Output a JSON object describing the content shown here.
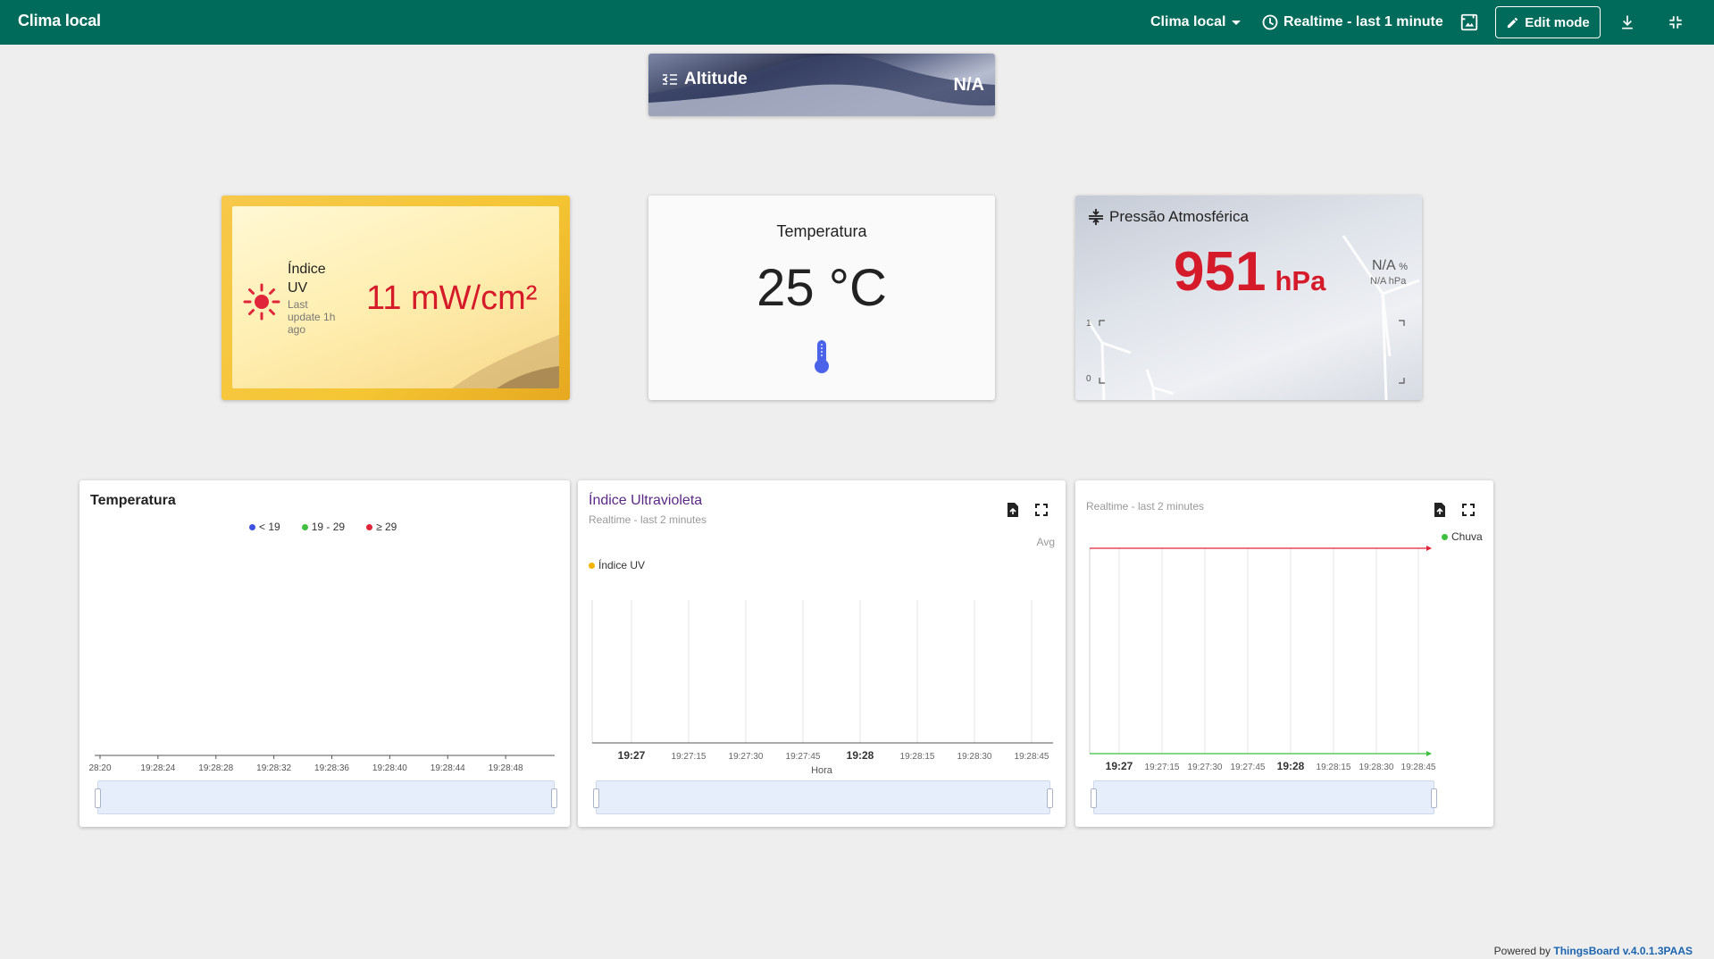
{
  "header": {
    "title": "Clima local",
    "dashboard_select": "Clima local",
    "timewindow": "Realtime - last 1 minute",
    "edit_mode": "Edit mode"
  },
  "altitude": {
    "label": "Altitude",
    "value": "N/A"
  },
  "uv_card": {
    "label": "Índice UV",
    "updated": "Last update 1h ago",
    "value": "11 mW/cm²"
  },
  "temperature_card": {
    "title": "Temperatura",
    "value": "25 °C"
  },
  "pressure_card": {
    "title": "Pressão Atmosférica",
    "value": "951",
    "unit": "hPa",
    "secondary_value": "N/A",
    "secondary_unit": "%",
    "tertiary": "N/A hPa",
    "axis_top": "1",
    "axis_bottom": "0"
  },
  "charts": {
    "temperature": {
      "title": "Temperatura",
      "legend": [
        {
          "label": "< 19",
          "color": "#3f51e0"
        },
        {
          "label": "19 - 29",
          "color": "#3fbf3f"
        },
        {
          "label": "≥ 29",
          "color": "#e0243a"
        }
      ],
      "x_ticks": [
        "28:20",
        "19:28:24",
        "19:28:28",
        "19:28:32",
        "19:28:36",
        "19:28:40",
        "19:28:44",
        "19:28:48"
      ]
    },
    "uv": {
      "title": "Índice Ultravioleta",
      "subtitle": "Realtime - last 2 minutes",
      "aggregation": "Avg",
      "legend": [
        {
          "label": "Índice UV",
          "color": "#f5b400"
        }
      ],
      "x_ticks": [
        "19:27",
        "19:27:15",
        "19:27:30",
        "19:27:45",
        "19:28",
        "19:28:15",
        "19:28:30",
        "19:28:45"
      ],
      "x_label": "Hora"
    },
    "rain": {
      "subtitle": "Realtime - last 2 minutes",
      "legend": [
        {
          "label": "Chuva",
          "color": "#3fbf3f"
        }
      ],
      "x_ticks": [
        "19:27",
        "19:27:15",
        "19:27:30",
        "19:27:45",
        "19:28",
        "19:28:15",
        "19:28:30",
        "19:28:45"
      ]
    }
  },
  "footer": {
    "prefix": "Powered by",
    "link": "ThingsBoard v.4.0.1.3PAAS"
  },
  "colors": {
    "header": "#006a5b",
    "value_red": "#d51a2a",
    "thermometer": "#4b63e8"
  }
}
